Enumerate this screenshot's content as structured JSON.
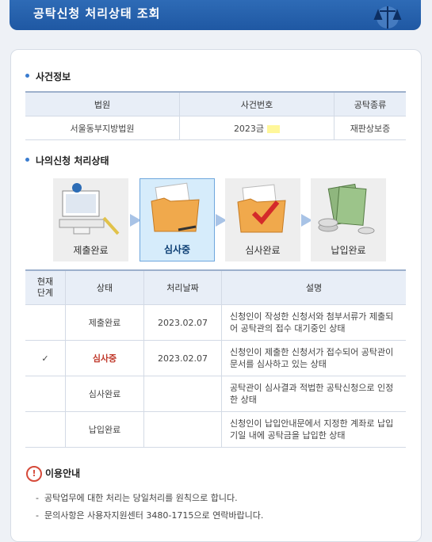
{
  "header": {
    "title": "공탁신청 처리상태 조회"
  },
  "case_section": {
    "title": "사건정보",
    "headers": [
      "법원",
      "사건번호",
      "공탁종류"
    ],
    "row": {
      "court": "서울동부지방법원",
      "case_no": "2023금",
      "type": "재판상보증"
    }
  },
  "status_section": {
    "title": "나의신청 처리상태",
    "steps": [
      "제출완료",
      "심사중",
      "심사완료",
      "납입완료"
    ],
    "active_step": "심사중",
    "table": {
      "headers": {
        "current": "현재\n단계",
        "status": "상태",
        "date": "처리날짜",
        "desc": "설명"
      },
      "rows": [
        {
          "check": "",
          "status": "제출완료",
          "date": "2023.02.07",
          "desc": "신청인이 작성한 신청서와 첨부서류가 제출되어 공탁관의 접수 대기중인 상태"
        },
        {
          "check": "✓",
          "status": "심사중",
          "date": "2023.02.07",
          "desc": "신청인이 제출한 신청서가 접수되어 공탁관이 문서를 심사하고 있는 상태"
        },
        {
          "check": "",
          "status": "심사완료",
          "date": "",
          "desc": "공탁관이 심사결과 적법한 공탁신청으로 인정한 상태"
        },
        {
          "check": "",
          "status": "납입완료",
          "date": "",
          "desc": "신청인이 납입안내문에서 지정한 계좌로 납입기일 내에 공탁금을 납입한 상태"
        }
      ]
    }
  },
  "info": {
    "title": "이용안내",
    "notes": [
      "공탁업무에 대한 처리는 당일처리를 원칙으로 합니다.",
      "문의사항은 사용자지원센터 3480-1715으로 연락바랍니다."
    ]
  }
}
